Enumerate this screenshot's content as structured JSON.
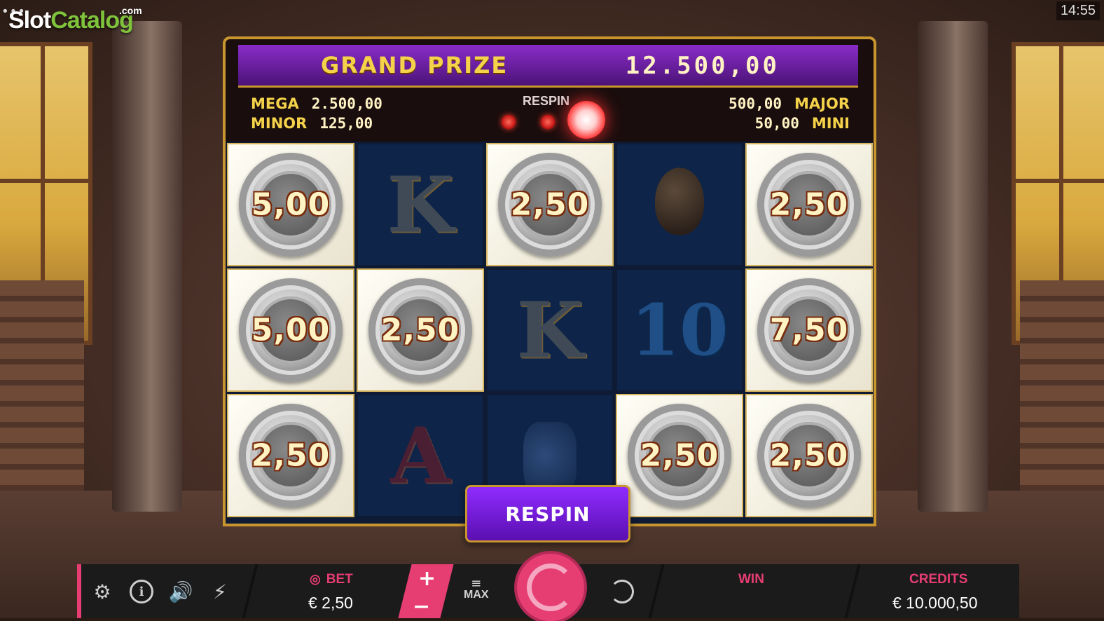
{
  "brand": {
    "logo_main": "Slot",
    "logo_accent": "Catalog",
    "logo_suffix": ".com"
  },
  "status": {
    "clock": "14:55"
  },
  "jackpots": {
    "grand_label": "GRAND PRIZE",
    "grand_value": "12.500,00",
    "mega_label": "MEGA",
    "mega_value": "2.500,00",
    "minor_label": "MINOR",
    "minor_value": "125,00",
    "major_label": "MAJOR",
    "major_value": "500,00",
    "mini_label": "MINI",
    "mini_value": "50,00",
    "respin_label": "RESPIN",
    "respins_remaining_indicator": 3
  },
  "reels": {
    "rows": [
      [
        {
          "type": "coin",
          "value": "5,00"
        },
        {
          "type": "symbol",
          "symbol": "K"
        },
        {
          "type": "coin",
          "value": "2,50"
        },
        {
          "type": "symbol",
          "symbol": "egg"
        },
        {
          "type": "coin",
          "value": "2,50"
        }
      ],
      [
        {
          "type": "coin",
          "value": "5,00"
        },
        {
          "type": "coin",
          "value": "2,50"
        },
        {
          "type": "symbol",
          "symbol": "K"
        },
        {
          "type": "symbol",
          "symbol": "10"
        },
        {
          "type": "coin",
          "value": "7,50"
        }
      ],
      [
        {
          "type": "coin",
          "value": "2,50"
        },
        {
          "type": "symbol",
          "symbol": "A"
        },
        {
          "type": "symbol",
          "symbol": "vase"
        },
        {
          "type": "coin",
          "value": "2,50"
        },
        {
          "type": "coin",
          "value": "2,50"
        }
      ]
    ]
  },
  "respin_button": {
    "label": "RESPIN"
  },
  "bottom_bar": {
    "bet_label": "BET",
    "bet_value": "€ 2,50",
    "plus_symbol": "+",
    "minus_symbol": "−",
    "max_label": "MAX",
    "win_label": "WIN",
    "credits_label": "CREDITS",
    "credits_value": "€ 10.000,50",
    "icons": [
      "gear-icon",
      "info-icon",
      "sound-icon",
      "turbo-icon",
      "max-bet-icon",
      "spin-icon",
      "autoplay-icon"
    ]
  },
  "colors": {
    "accent": "#e63d73",
    "gold": "#c9952f",
    "grand_bar": "#6a1fa8",
    "jackpot_text": "#f4d24a"
  }
}
